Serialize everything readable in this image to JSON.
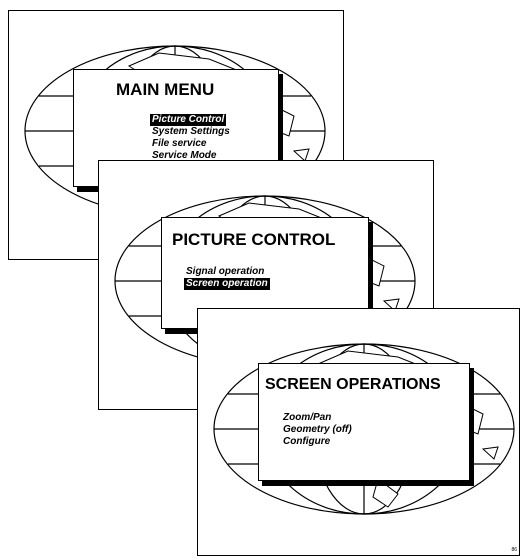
{
  "screens": [
    {
      "title": "MAIN MENU",
      "items": [
        {
          "label": "Picture Control",
          "selected": true
        },
        {
          "label": "System Settings",
          "selected": false
        },
        {
          "label": "File service",
          "selected": false
        },
        {
          "label": "Service Mode",
          "selected": false
        }
      ]
    },
    {
      "title": "PICTURE CONTROL",
      "items": [
        {
          "label": "Signal operation",
          "selected": false
        },
        {
          "label": "Screen operation",
          "selected": true
        }
      ]
    },
    {
      "title": "SCREEN OPERATIONS",
      "items": [
        {
          "label": "Zoom/Pan",
          "selected": false
        },
        {
          "label": "Geometry (off)",
          "selected": false
        },
        {
          "label": "Configure",
          "selected": false
        }
      ]
    }
  ],
  "figure_code": "86"
}
